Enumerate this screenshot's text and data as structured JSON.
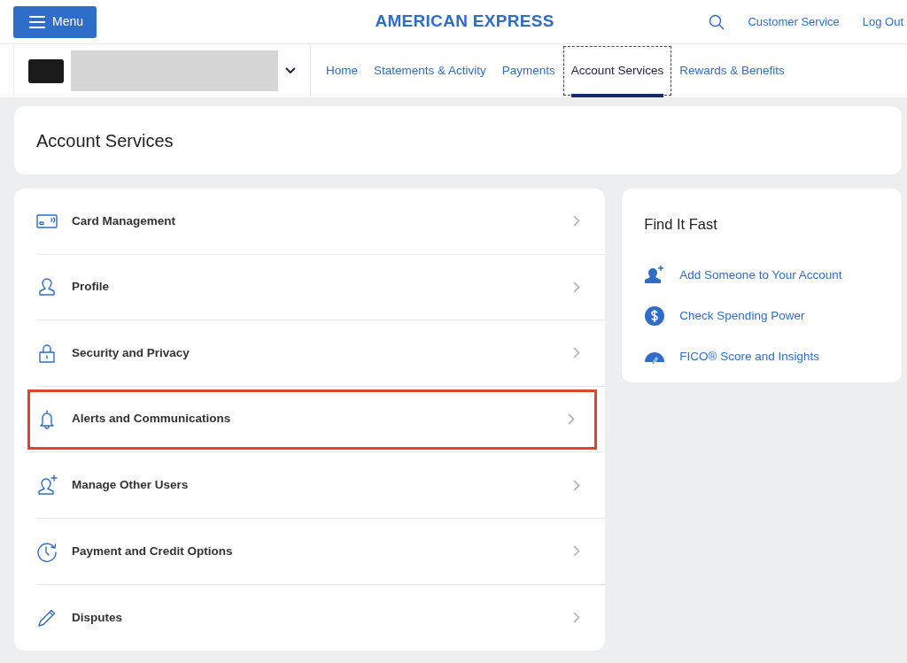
{
  "header": {
    "menu_button": "Menu",
    "logo": "AMERICAN EXPRESS",
    "links": [
      "Customer Service",
      "Log Out"
    ]
  },
  "nav": {
    "tabs": [
      {
        "label": "Home",
        "selected": false
      },
      {
        "label": "Statements & Activity",
        "selected": false
      },
      {
        "label": "Payments",
        "selected": false
      },
      {
        "label": "Account Services",
        "selected": true
      },
      {
        "label": "Rewards & Benefits",
        "selected": false
      }
    ]
  },
  "page_title": "Account Services",
  "services": [
    {
      "kind": "card",
      "label": "Card Management",
      "highlighted": false
    },
    {
      "kind": "profile",
      "label": "Profile",
      "highlighted": false
    },
    {
      "kind": "lock",
      "label": "Security and Privacy",
      "highlighted": false
    },
    {
      "kind": "bell",
      "label": "Alerts and Communications",
      "highlighted": true
    },
    {
      "kind": "user-plus",
      "label": "Manage Other Users",
      "highlighted": false
    },
    {
      "kind": "clock",
      "label": "Payment and Credit Options",
      "highlighted": false
    },
    {
      "kind": "pencil",
      "label": "Disputes",
      "highlighted": false
    }
  ],
  "find_it_fast": {
    "title": "Find It Fast",
    "links": [
      {
        "kind": "person-plus",
        "label": "Add Someone to Your Account"
      },
      {
        "kind": "dollar",
        "label": "Check Spending Power"
      },
      {
        "kind": "gauge",
        "label": "FICO® Score and Insights"
      }
    ]
  }
}
